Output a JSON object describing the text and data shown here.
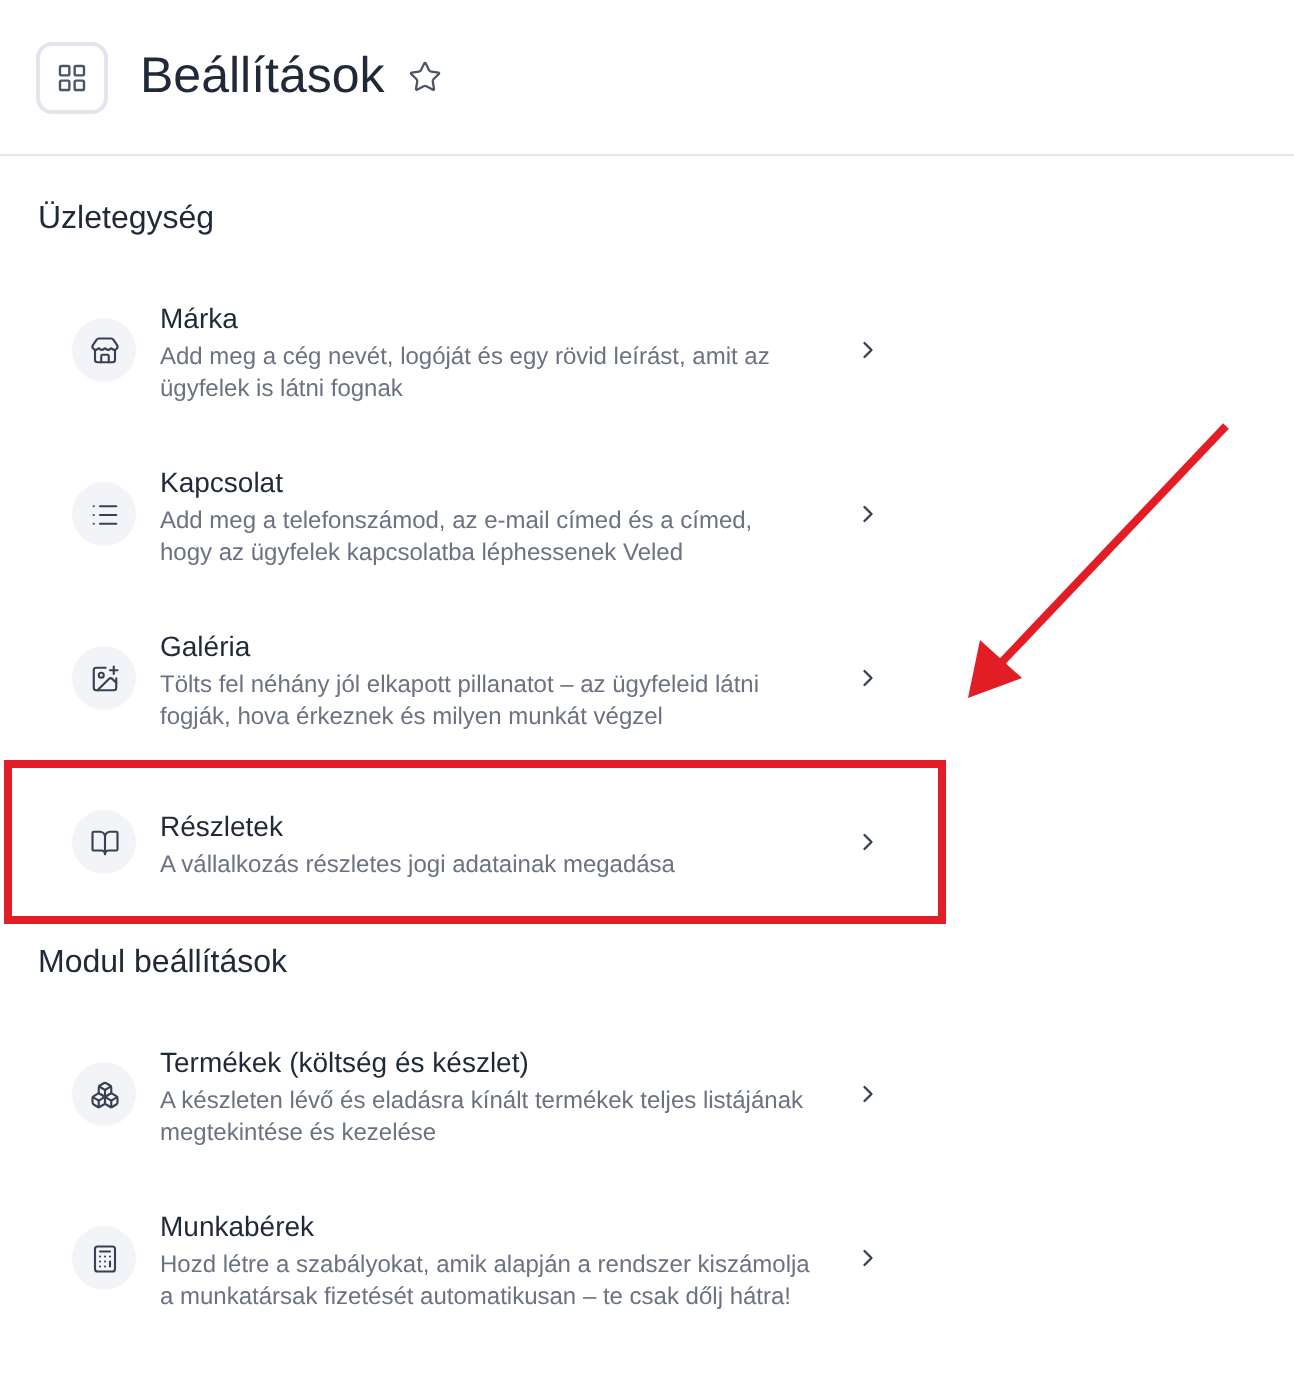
{
  "header": {
    "title": "Beállítások",
    "favorite": false
  },
  "sections": [
    {
      "title": "Üzletegység",
      "items": [
        {
          "title": "Márka",
          "description": "Add meg a cég nevét, logóját és egy rövid leírást, amit az ügyfelek is látni fognak",
          "highlighted": false
        },
        {
          "title": "Kapcsolat",
          "description": "Add meg a telefonszámod, az e-mail címed és a címed, hogy az ügyfelek kapcsolatba léphessenek Veled",
          "highlighted": false
        },
        {
          "title": "Galéria",
          "description": "Tölts fel néhány jól elkapott pillanatot – az ügyfeleid látni fogják, hova érkeznek és milyen munkát végzel",
          "highlighted": false
        },
        {
          "title": "Részletek",
          "description": "A vállalkozás részletes jogi adatainak megadása",
          "highlighted": true
        }
      ]
    },
    {
      "title": "Modul beállítások",
      "items": [
        {
          "title": "Termékek (költség és készlet)",
          "description": "A készleten lévő és eladásra kínált termékek teljes listájának megtekintése és kezelése",
          "highlighted": false
        },
        {
          "title": "Munkabérek",
          "description": "Hozd létre a szabályokat, amik alapján a rendszer kiszámolja a munkatársak fizetését automatikusan – te csak dőlj hátra!",
          "highlighted": false
        }
      ]
    }
  ]
}
